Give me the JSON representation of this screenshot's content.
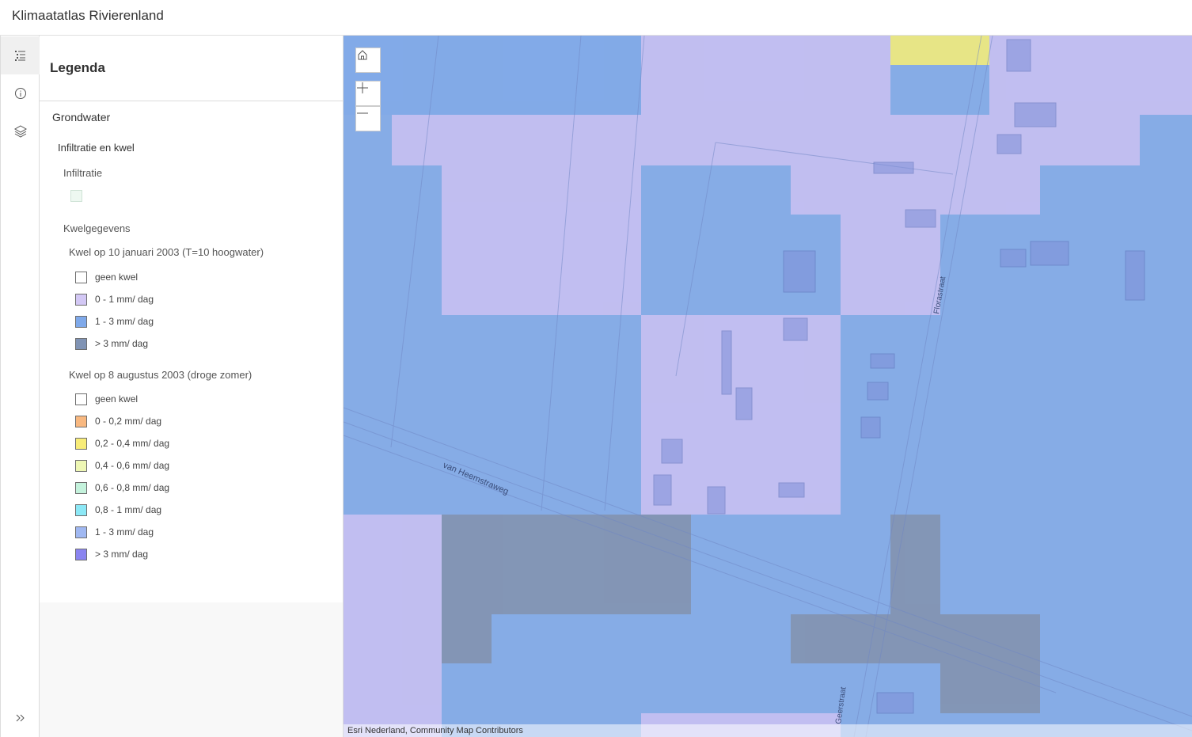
{
  "app": {
    "title": "Klimaatatlas Rivierenland"
  },
  "panel": {
    "title": "Legenda",
    "group": "Grondwater",
    "layer": "Infiltratie en kwel",
    "sublayer1": "Infiltratie",
    "sublayer2": "Kwelgegevens",
    "legend1": {
      "title": "Kwel op 10 januari 2003 (T=10 hoogwater)",
      "items": [
        {
          "label": "geen kwel",
          "color": "#ffffff"
        },
        {
          "label": "0 - 1 mm/ dag",
          "color": "#d3c8f5"
        },
        {
          "label": "1 - 3 mm/ dag",
          "color": "#7fa9ea"
        },
        {
          "label": "> 3 mm/ dag",
          "color": "#8093b4"
        }
      ]
    },
    "legend2": {
      "title": "Kwel op 8 augustus 2003 (droge zomer)",
      "items": [
        {
          "label": "geen kwel",
          "color": "#ffffff"
        },
        {
          "label": "0 - 0,2 mm/ dag",
          "color": "#f8b880"
        },
        {
          "label": "0,2 - 0,4 mm/ dag",
          "color": "#f8ec78"
        },
        {
          "label": "0,4 - 0,6 mm/ dag",
          "color": "#eef7b4"
        },
        {
          "label": "0,6 - 0,8 mm/ dag",
          "color": "#c4f2dc"
        },
        {
          "label": "0,8 - 1 mm/ dag",
          "color": "#8ce8f6"
        },
        {
          "label": "1 - 3 mm/ dag",
          "color": "#a0b8f2"
        },
        {
          "label": "> 3 mm/ dag",
          "color": "#8a84f0"
        }
      ]
    }
  },
  "map": {
    "streets": [
      "van Heemstraweg",
      "Florastraat",
      "Geerstraat"
    ],
    "attribution": "Esri Nederland, Community Map Contributors",
    "colors": {
      "lavender": "#c8c0f2",
      "blue": "#82aae8",
      "gray": "#8393b0",
      "yellow": "#f2ec7c"
    }
  }
}
